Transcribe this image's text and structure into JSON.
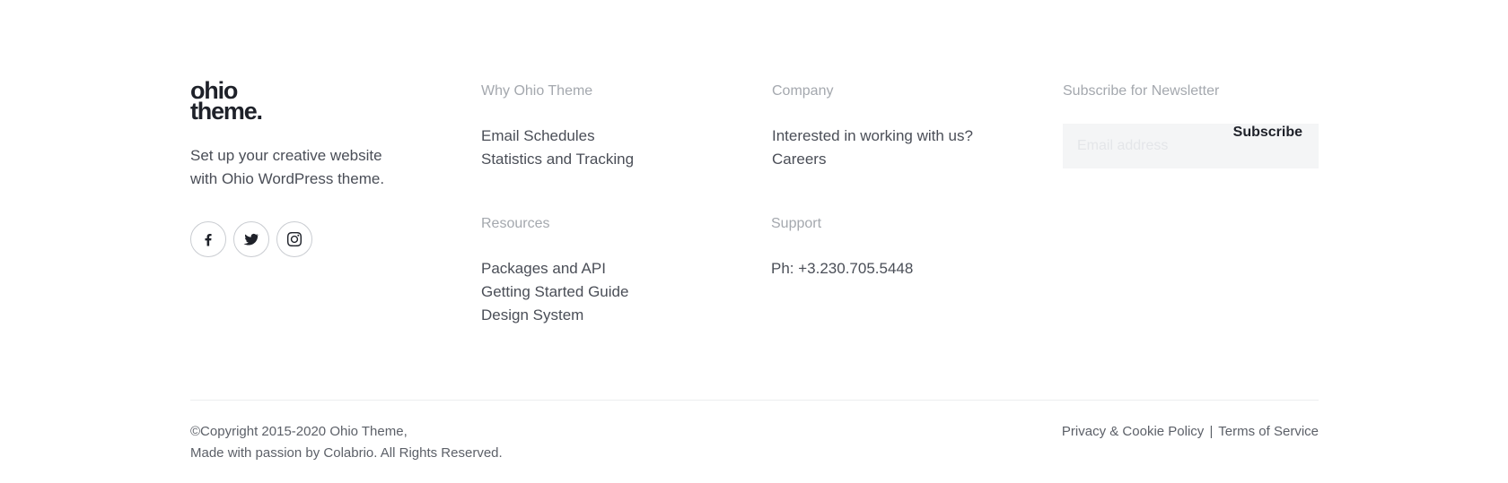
{
  "brand": {
    "logo_line1": "ohio",
    "logo_line2": "theme.",
    "tagline_line1": "Set up your creative website",
    "tagline_line2": "with Ohio WordPress theme."
  },
  "socials": [
    {
      "icon": "facebook-icon"
    },
    {
      "icon": "twitter-icon"
    },
    {
      "icon": "instagram-icon"
    }
  ],
  "why": {
    "title": "Why Ohio Theme",
    "links": [
      "Email Schedules",
      "Statistics and Tracking"
    ]
  },
  "resources": {
    "title": "Resources",
    "links": [
      "Packages and API",
      "Getting Started Guide",
      "Design System"
    ]
  },
  "company": {
    "title": "Company",
    "links": [
      "Interested in working with us?",
      "Careers"
    ]
  },
  "support": {
    "title": "Support",
    "phone": "Ph: +3.230.705.5448"
  },
  "newsletter": {
    "title": "Subscribe for Newsletter",
    "placeholder": "Email address",
    "button": "Subscribe"
  },
  "copyright": {
    "line1": "©Copyright 2015-2020 Ohio Theme,",
    "line2": "Made with passion by Colabrio. All Rights Reserved."
  },
  "legal": {
    "privacy": "Privacy & Cookie Policy",
    "separator": "|",
    "terms": "Terms of Service"
  }
}
